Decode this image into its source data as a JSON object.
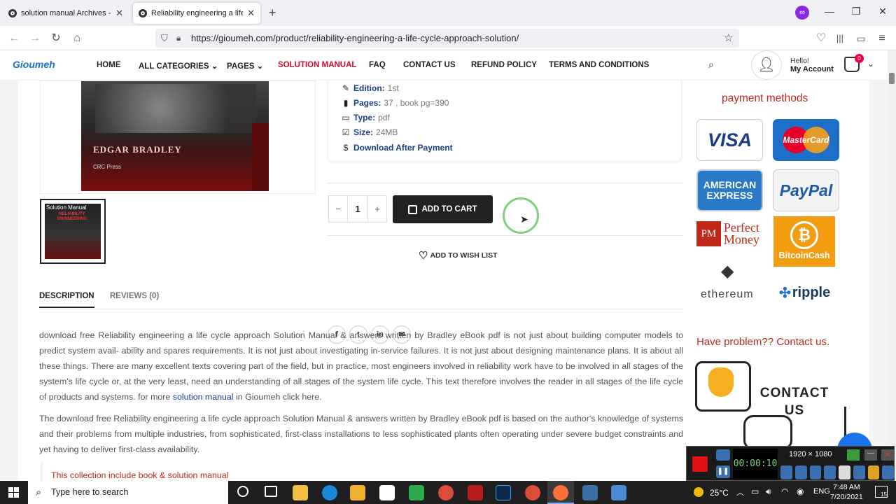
{
  "browser": {
    "tabs": [
      {
        "title": "solution manual Archives - Solu"
      },
      {
        "title": "Reliability engineering a life cyc"
      }
    ],
    "new_tab": "+",
    "url": "https://gioumeh.com/product/reliability-engineering-a-life-cycle-approach-solution/"
  },
  "site": {
    "logo": "Gioumeh",
    "menu": [
      "HOME",
      "ALL CATEGORIES",
      "PAGES",
      "SOLUTION MANUAL",
      "FAQ",
      "CONTACT US",
      "REFUND POLICY",
      "TERMS AND CONDITIONS"
    ],
    "greeting": "Hello!",
    "account": "My Account",
    "cart_count": "0"
  },
  "product": {
    "book_author": "EDGAR BRADLEY",
    "publisher": "CRC Press",
    "thumb_title": "Solution Manual",
    "thumb_subtitle": "RELIABILITY ENGINEERING",
    "meta": {
      "edition_label": "Edition:",
      "edition": "1st",
      "pages_label": "Pages:",
      "pages": "37 , book pg=390",
      "type_label": "Type:",
      "type": "pdf",
      "size_label": "Size:",
      "size": "24MB",
      "download": "Download After Payment"
    },
    "qty": "1",
    "add_to_cart": "ADD TO CART",
    "wishlist": "ADD TO WISH LIST"
  },
  "tabs": {
    "description": "DESCRIPTION",
    "reviews": "REVIEWS (0)"
  },
  "description": {
    "p1": "download free Reliability engineering a life cycle approach Solution Manual & answers written by Bradley eBook pdf  is not just about building computer models to predict system avail- ability and spares requirements. It is not just about investigating in-service failures. It is not just about designing maintenance plans. It is about all these things. There are many excellent texts covering part of the field, but in practice, most engineers involved in reliability work have to be involved in all stages of the system's life cycle or, at the very least, need an understanding of all stages of the system life cycle. This text therefore involves the reader in all stages of the life cycle of products and systems. for more",
    "p1_link": "solution manual",
    "p1_end": " in Gioumeh click here.",
    "p2": "The download free Reliability engineering a life cycle approach Solution Manual & answers written by Bradley eBook pdf is based on the author's knowledge of systems and their problems from multiple industries, from sophisticated, first-class installations to less sophisticated plants often operating under severe budget constraints and yet having to deliver first-class availability.",
    "note": "This collection include book & solution manual"
  },
  "sidebar": {
    "payment_title": "payment methods",
    "payments": [
      "VISA",
      "MasterCard",
      "AMERICAN EXPRESS",
      "PayPal",
      "PM",
      "Perfect Money",
      "BitcoinCash",
      "ethereum",
      "ripple"
    ],
    "contact_title": "Have problem?? Contact us.",
    "contact_text": "CONTACT US"
  },
  "recorder": {
    "resolution": "1920 × 1080",
    "timer": "00:00:10"
  },
  "taskbar": {
    "search": "Type here to search",
    "weather": "25°C",
    "time": "7:48 AM",
    "date": "7/20/2021",
    "lang": "ENG",
    "notif": "15"
  },
  "colors": {
    "accent_red": "#c8102e",
    "link_blue": "#1a3a8a",
    "dark_button": "#222"
  }
}
